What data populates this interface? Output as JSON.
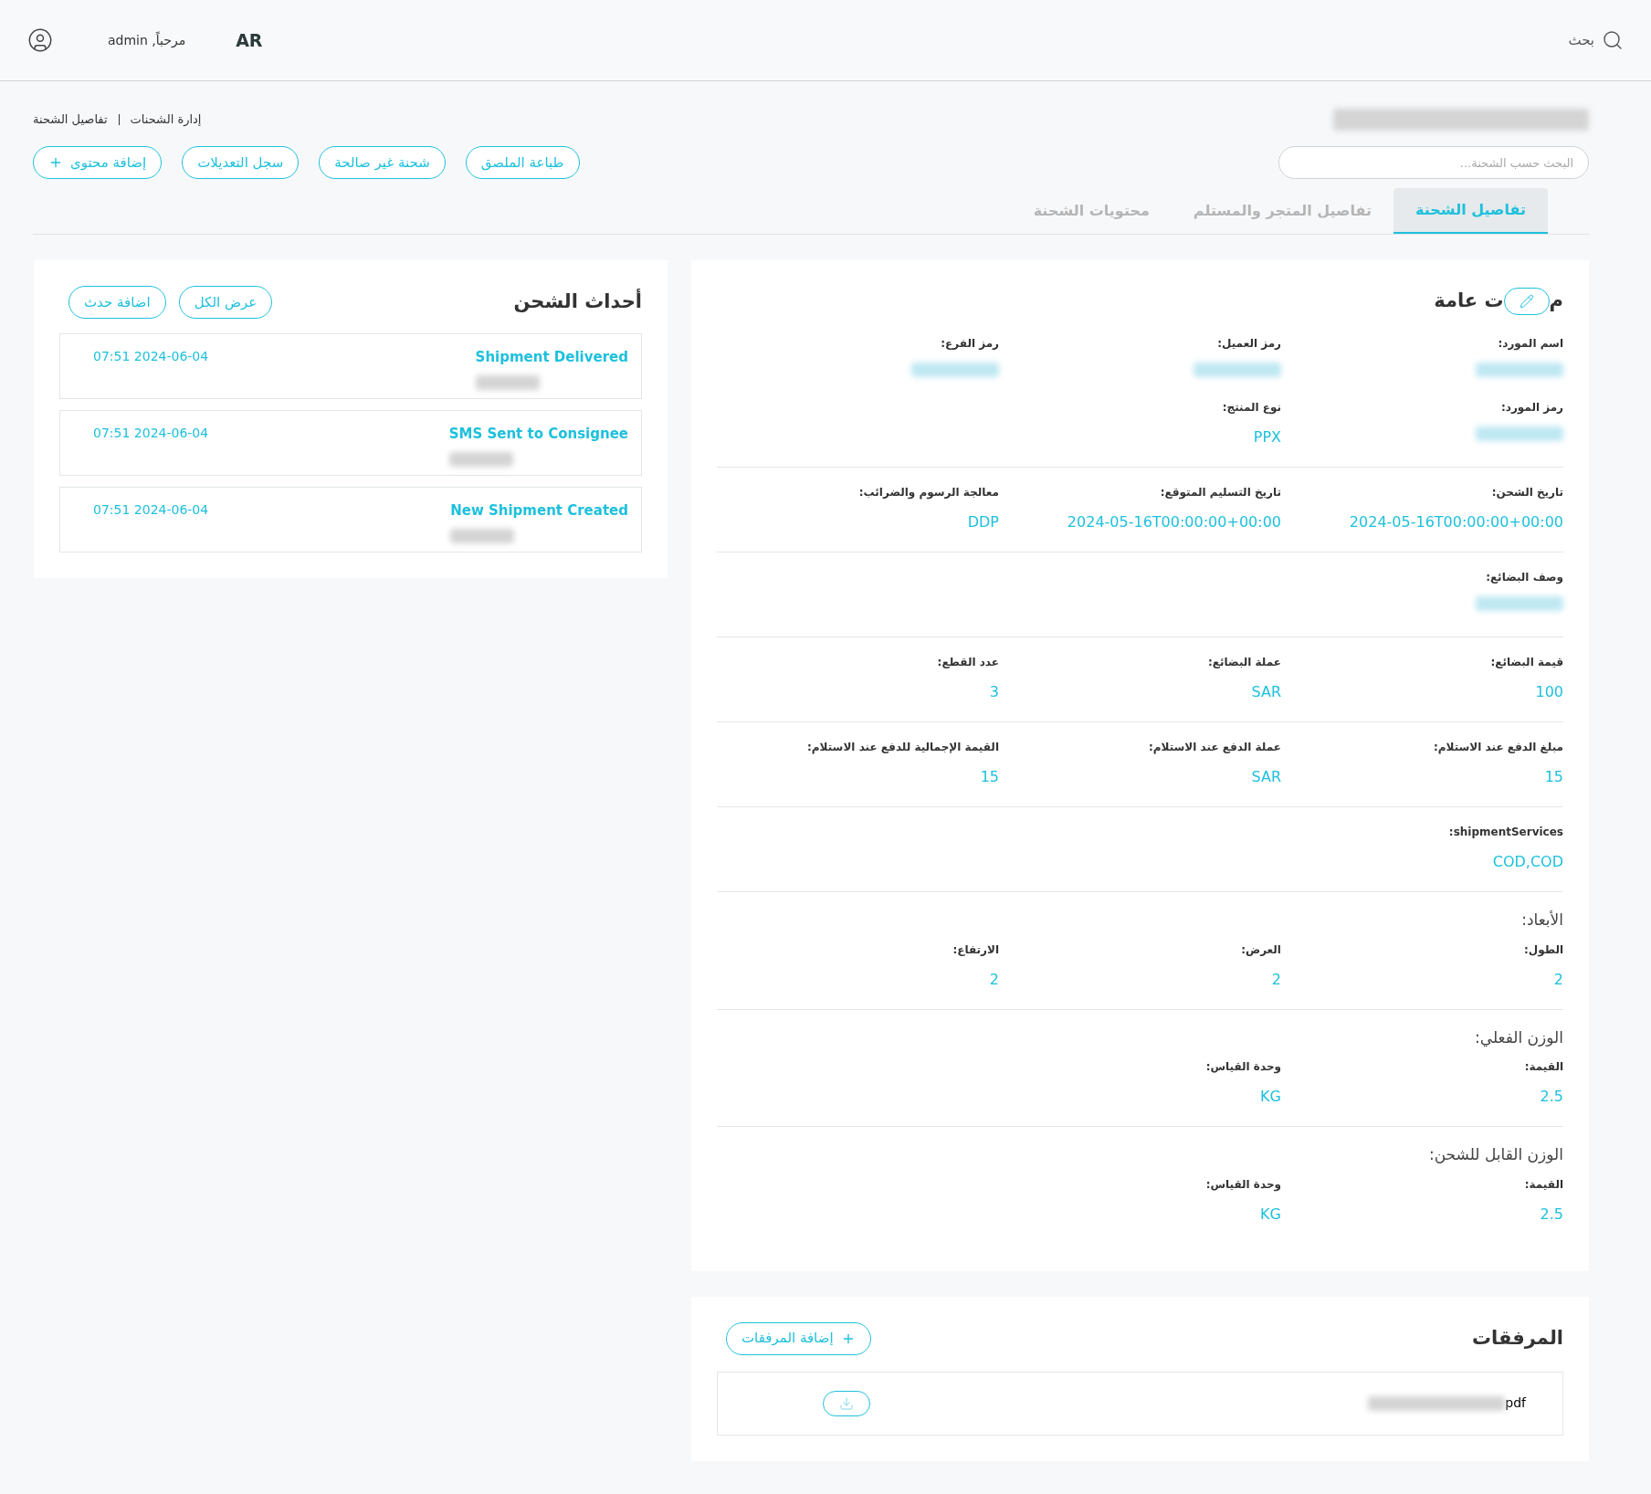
{
  "header": {
    "welcome": "مرحباً, admin",
    "language": "AR",
    "search_label": "بحث"
  },
  "breadcrumb": [
    "إدارة الشحنات",
    "تفاصيل الشحنة"
  ],
  "shipment_number": {
    "redacted": true
  },
  "search": {
    "placeholder": "البحث حسب الشحنة..."
  },
  "actions": [
    {
      "label": "طباعة الملصق",
      "kind": "plain"
    },
    {
      "label": "شحنة غير صالحة",
      "kind": "plain"
    },
    {
      "label": "سجل التعديلات",
      "kind": "plain"
    },
    {
      "label": "إضافة محتوى",
      "kind": "add"
    }
  ],
  "tabs": [
    {
      "label": "تفاصيل الشحنة",
      "selected": true
    },
    {
      "label": "تفاصيل المتجر والمستلم",
      "selected": false
    },
    {
      "label": "محتويات الشحنة",
      "selected": false
    }
  ],
  "details": {
    "title_parts": [
      "م",
      "ت عامة"
    ],
    "sections": [
      {
        "fields": [
          {
            "label": "اسم المورد:",
            "redacted": true
          },
          {
            "label": "رمز العميل:",
            "redacted": true
          },
          {
            "label": "رمز الفرع:",
            "redacted": true
          },
          {
            "label": "رمز المورد:",
            "redacted": true
          },
          {
            "label": "نوع المنتج:",
            "value": "PPX"
          }
        ]
      },
      {
        "fields": [
          {
            "label": "تاريخ الشحن:",
            "value": "2024-05-16T00:00:00+00:00"
          },
          {
            "label": "تاريخ التسليم المتوقع:",
            "value": "2024-05-16T00:00:00+00:00"
          },
          {
            "label": "معالجة الرسوم والضرائب:",
            "value": "DDP"
          }
        ]
      },
      {
        "fields": [
          {
            "label": "وصف البضائع:",
            "redacted": true
          }
        ]
      },
      {
        "fields": [
          {
            "label": "قيمة البضائع:",
            "value": "100"
          },
          {
            "label": "عملة البضائع:",
            "value": "SAR"
          },
          {
            "label": "عدد القطع:",
            "value": "3"
          }
        ]
      },
      {
        "fields": [
          {
            "label": "مبلغ الدفع عند الاستلام:",
            "value": "15"
          },
          {
            "label": "عملة الدفع عند الاستلام:",
            "value": "SAR"
          },
          {
            "label": "القيمة الإجمالية للدفع عند الاستلام:",
            "value": "15"
          }
        ]
      },
      {
        "fields": [
          {
            "label": "shipmentServices:",
            "value": "COD,COD"
          }
        ]
      },
      {
        "heading": "الأبعاد:",
        "fields": [
          {
            "label": "الطول:",
            "value": "2"
          },
          {
            "label": "العرض:",
            "value": "2"
          },
          {
            "label": "الارتفاع:",
            "value": "2"
          }
        ]
      },
      {
        "heading": "الوزن الفعلي:",
        "fields": [
          {
            "label": "القيمة:",
            "value": "2.5"
          },
          {
            "label": "وحدة القياس:",
            "value": "KG"
          }
        ]
      },
      {
        "heading": "الوزن القابل للشحن:",
        "fields": [
          {
            "label": "القيمة:",
            "value": "2.5"
          },
          {
            "label": "وحدة القياس:",
            "value": "KG"
          }
        ]
      }
    ]
  },
  "events": {
    "title": "أحداث الشحن",
    "buttons": [
      "عرض الكل",
      "اضافة حدث"
    ],
    "items": [
      {
        "title": "Shipment Delivered",
        "time": "2024-06-04 07:51",
        "detail_redacted": true
      },
      {
        "title": "SMS Sent to Consignee",
        "time": "2024-06-04 07:51",
        "detail_redacted": true
      },
      {
        "title": "New Shipment Created",
        "time": "2024-06-04 07:51",
        "detail_redacted": true
      }
    ]
  },
  "attachments": {
    "title": "المرفقات",
    "add_button": "إضافة المرفقات",
    "files": [
      {
        "name_redacted": true,
        "extension": "pdf"
      }
    ]
  }
}
